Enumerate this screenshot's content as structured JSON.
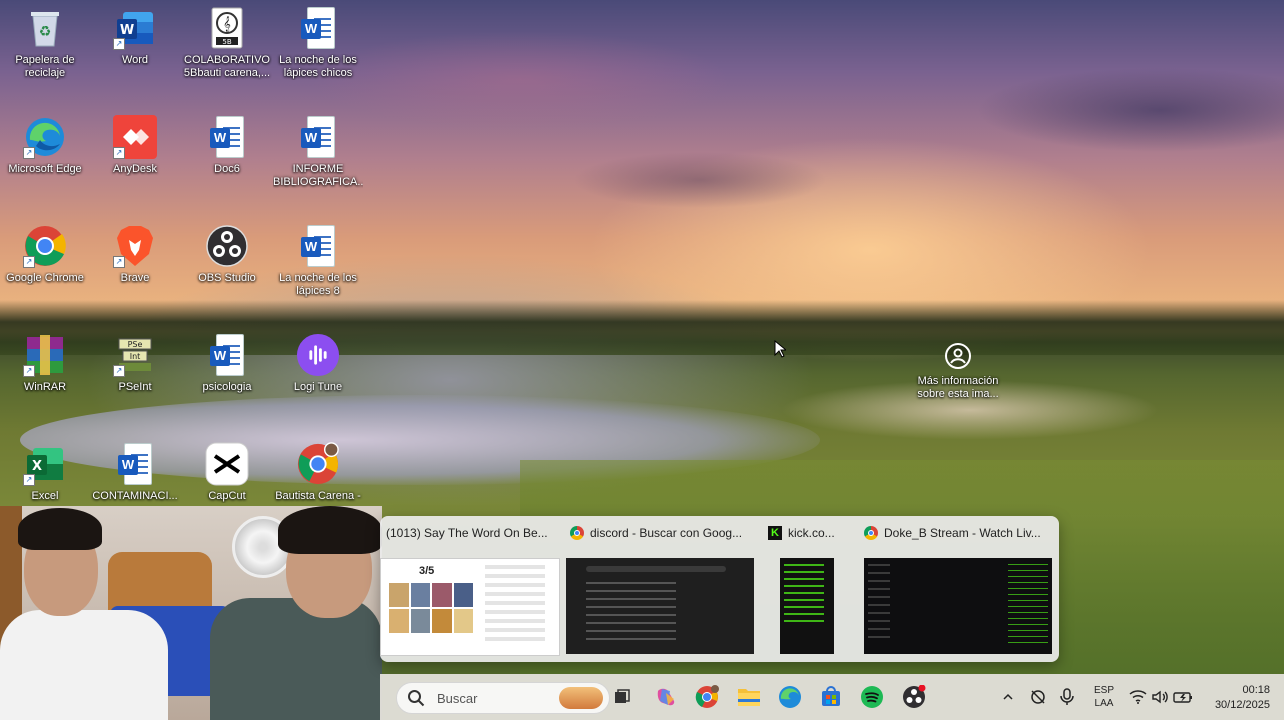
{
  "desktop": {
    "icons": [
      {
        "label": "Papelera de reciclaje",
        "icon": "recycle-bin-icon"
      },
      {
        "label": "Word",
        "icon": "word-app-icon"
      },
      {
        "label": "COLABORATIVO 5Bbauti carena,...",
        "icon": "music-doc-icon"
      },
      {
        "label": "La noche de los lápices chicos",
        "icon": "word-doc-icon"
      },
      {
        "label": "Microsoft Edge",
        "icon": "edge-icon"
      },
      {
        "label": "AnyDesk",
        "icon": "anydesk-icon"
      },
      {
        "label": "Doc6",
        "icon": "word-doc-icon"
      },
      {
        "label": "INFORME BIBLIOGRAFICA...",
        "icon": "word-doc-icon"
      },
      {
        "label": "Google Chrome",
        "icon": "chrome-icon"
      },
      {
        "label": "Brave",
        "icon": "brave-icon"
      },
      {
        "label": "OBS Studio",
        "icon": "obs-icon"
      },
      {
        "label": "La noche de los lápices 8",
        "icon": "word-doc-icon"
      },
      {
        "label": "WinRAR",
        "icon": "winrar-icon"
      },
      {
        "label": "PSeInt",
        "icon": "pseint-icon"
      },
      {
        "label": "psicologia",
        "icon": "word-doc-icon"
      },
      {
        "label": "Logi Tune",
        "icon": "logi-tune-icon"
      },
      {
        "label": "Excel",
        "icon": "excel-icon"
      },
      {
        "label": "CONTAMINACI...",
        "icon": "word-doc-icon"
      },
      {
        "label": "CapCut",
        "icon": "capcut-icon"
      },
      {
        "label": "Bautista Carena -",
        "icon": "chrome-profile-icon"
      }
    ],
    "spotlight": {
      "label": "Más información sobre esta ima..."
    }
  },
  "preview": {
    "cards": [
      {
        "title": "(1013) Say The Word On Be...",
        "favicon": "youtube-icon",
        "thumb_text": "3/5"
      },
      {
        "title": "discord - Buscar con Goog...",
        "favicon": "chrome-icon"
      },
      {
        "title": "kick.co...",
        "favicon": "kick-icon"
      },
      {
        "title": "Doke_B Stream - Watch Liv...",
        "favicon": "chrome-icon"
      }
    ]
  },
  "taskbar": {
    "search_placeholder": "Buscar",
    "lang_top": "ESP",
    "lang_bottom": "LAA",
    "time": "00:18",
    "date": "30/12/2025",
    "accent": "#0067c0"
  }
}
